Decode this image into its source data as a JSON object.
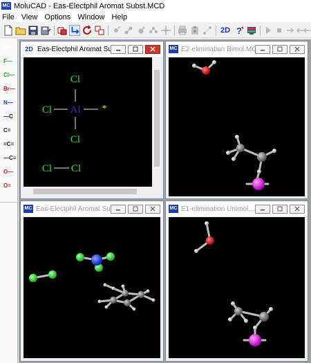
{
  "app": {
    "title": "MoluCAD - Eas-Electphil Aromat Subst.MCD",
    "icon": "molucad-app-icon",
    "icon_text": "MC"
  },
  "menu": [
    "File",
    "View",
    "Options",
    "Window",
    "Help"
  ],
  "toolbar": {
    "items": [
      "new-file-icon",
      "open-folder-icon",
      "save-icon",
      "save-as-icon",
      "select-icon",
      "rotate-icon",
      "refresh-icon",
      "copy-structure-icon",
      "atom-tool-icon",
      "bond-tool-icon",
      "ring-tool-icon",
      "chain-tool-icon",
      "move-tool-icon",
      "print-icon",
      "clipboard-icon",
      "fragment-icon",
      "help-icon",
      "monitor-icon",
      "play-icon",
      "stop-icon",
      "step-forward-icon",
      "step-back-icon",
      "rewind-icon"
    ],
    "mode_2d_label": "2D"
  },
  "palette": [
    {
      "label": "H—",
      "color": "#ffffff"
    },
    {
      "label": "F—",
      "color": "#2d9a2d"
    },
    {
      "label": "Cl—",
      "color": "#1fae1f"
    },
    {
      "label": "Br—",
      "color": "#b81e1e"
    },
    {
      "label": "N—",
      "color": "#1a3fd0"
    },
    {
      "label": "—C",
      "color": "#202020"
    },
    {
      "label": "C=",
      "color": "#202020"
    },
    {
      "label": "=C=",
      "color": "#202020"
    },
    {
      "label": "—C≡",
      "color": "#202020"
    },
    {
      "label": "O—",
      "color": "#cc1a1a"
    },
    {
      "label": "O=",
      "color": "#cc1a1a"
    }
  ],
  "windows": [
    {
      "title": "Eas-Electphil Aromat Su...",
      "icon": "2D",
      "state": "active"
    },
    {
      "title": "E2-elimination Bimol.MCD",
      "icon": "MC",
      "state": "inactive"
    },
    {
      "title": "Eas-Electphil Aromat Su...",
      "icon": "MC",
      "state": "inactive"
    },
    {
      "title": "E1-elimination Unimol....",
      "icon": "MC",
      "state": "inactive"
    }
  ],
  "structure_2d": {
    "atoms": {
      "top_cl": "Cl",
      "left_cl": "Cl",
      "center_al": "Al",
      "right_marker": "*",
      "bottom_cl": "Cl",
      "lone_cl_left": "Cl",
      "lone_cl_right": "Cl"
    },
    "colors": {
      "chlorine": "#33e033",
      "aluminum": "#1f3cb0",
      "marker": "#f2e000",
      "bond": "#e8e8e8"
    }
  },
  "colors": {
    "carbon": "#6a6a6a",
    "hydrogen": "#ffffff",
    "oxygen": "#e01010",
    "chlorine": "#22dd22",
    "aluminum": "#1238e0",
    "halide": "#e020e0",
    "active_border": "#6d8bbf",
    "close_button": "#c9362a"
  }
}
